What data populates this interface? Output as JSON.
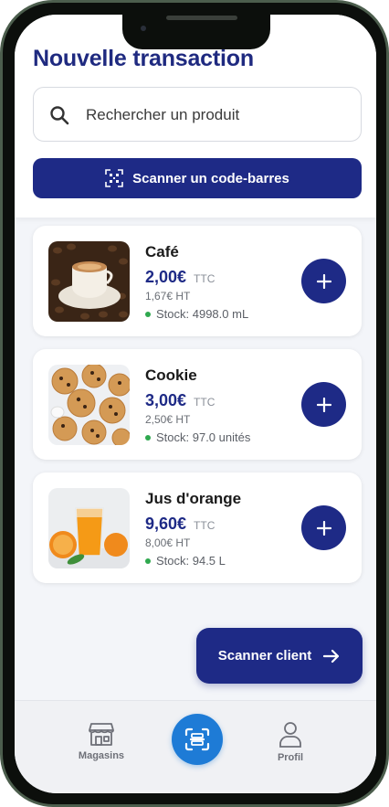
{
  "page": {
    "title": "Nouvelle transaction"
  },
  "search": {
    "placeholder": "Rechercher un produit"
  },
  "scan_barcode": {
    "label": "Scanner un code-barres"
  },
  "products": [
    {
      "name": "Café",
      "price": "2,00€",
      "tax_label": "TTC",
      "price_ht": "1,67€ HT",
      "stock": "Stock: 4998.0 mL"
    },
    {
      "name": "Cookie",
      "price": "3,00€",
      "tax_label": "TTC",
      "price_ht": "2,50€ HT",
      "stock": "Stock: 97.0 unités"
    },
    {
      "name": "Jus d'orange",
      "price": "9,60€",
      "tax_label": "TTC",
      "price_ht": "8,00€ HT",
      "stock": "Stock: 94.5 L"
    }
  ],
  "scan_client": {
    "label": "Scanner client"
  },
  "nav": {
    "items": [
      {
        "label": "Magasins",
        "icon": "store-icon"
      },
      {
        "label": "",
        "icon": "scan-icon"
      },
      {
        "label": "Profil",
        "icon": "user-icon"
      }
    ]
  },
  "colors": {
    "primary": "#1e2a86",
    "accent_blue": "#1e7bd6",
    "stock_ok": "#2fa84f"
  }
}
